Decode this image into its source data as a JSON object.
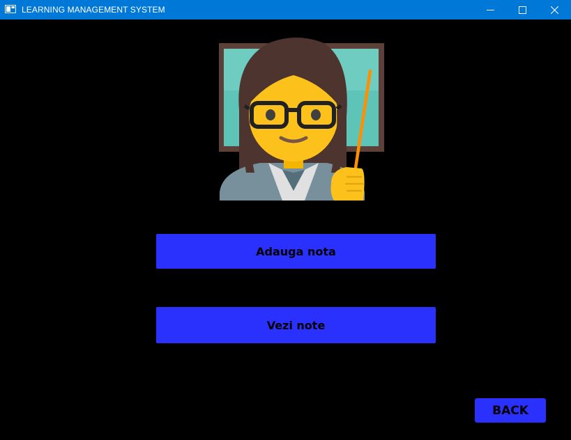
{
  "window": {
    "title": "LEARNING MANAGEMENT SYSTEM"
  },
  "illustration": {
    "icon": "teacher-icon"
  },
  "buttons": {
    "add_grade": "Adauga nota",
    "view_grades": "Vezi note",
    "back": "BACK"
  },
  "colors": {
    "titlebar": "#0078d7",
    "background": "#000000",
    "button": "#2b31fc"
  }
}
